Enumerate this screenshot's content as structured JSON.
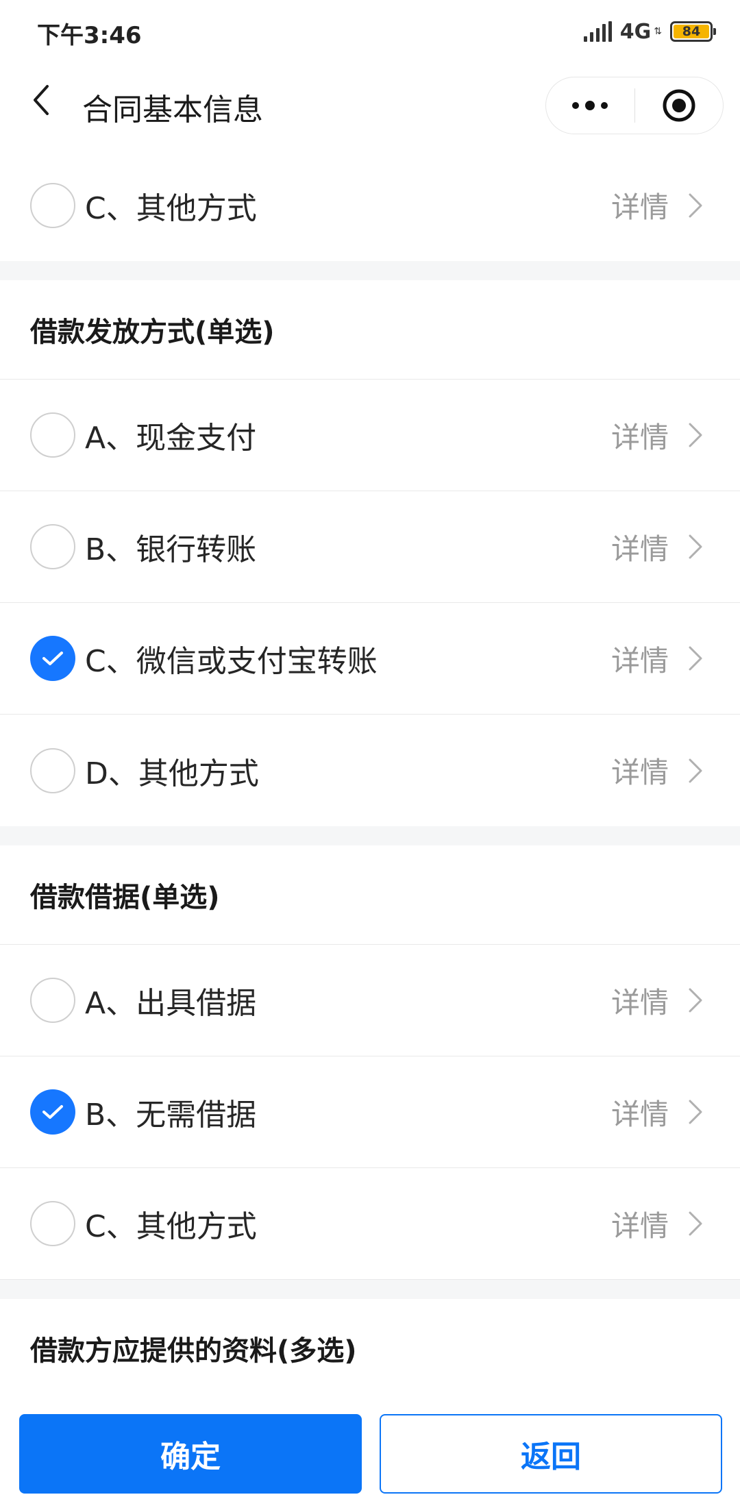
{
  "status_bar": {
    "time": "下午3:46",
    "network": "4G",
    "battery": "84"
  },
  "nav": {
    "title": "合同基本信息"
  },
  "detail_label": "详情",
  "prev_section": {
    "options": [
      {
        "label": "C、其他方式",
        "checked": false
      }
    ]
  },
  "sections": [
    {
      "title": "借款发放方式(单选)",
      "options": [
        {
          "label": "A、现金支付",
          "checked": false
        },
        {
          "label": "B、银行转账",
          "checked": false
        },
        {
          "label": "C、微信或支付宝转账",
          "checked": true
        },
        {
          "label": "D、其他方式",
          "checked": false
        }
      ]
    },
    {
      "title": "借款借据(单选)",
      "options": [
        {
          "label": "A、出具借据",
          "checked": false
        },
        {
          "label": "B、无需借据",
          "checked": true
        },
        {
          "label": "C、其他方式",
          "checked": false
        }
      ]
    },
    {
      "title": "借款方应提供的资料(多选)",
      "options": []
    }
  ],
  "buttons": {
    "confirm": "确定",
    "back": "返回"
  },
  "colors": {
    "accent": "#0b75f7",
    "battery": "#f5b400"
  }
}
